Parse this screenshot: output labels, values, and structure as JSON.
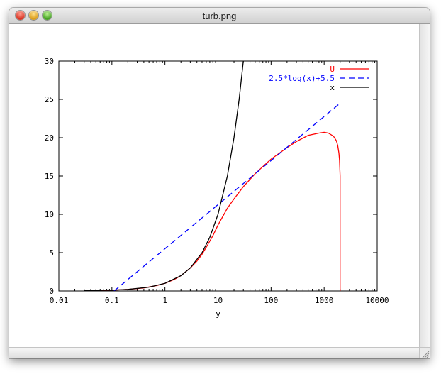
{
  "window": {
    "title": "turb.png"
  },
  "chart_data": {
    "type": "line",
    "title": "",
    "xlabel": "y",
    "ylabel": "",
    "xscale": "log",
    "xlim": [
      0.01,
      10000
    ],
    "ylim": [
      0,
      30
    ],
    "xticks": [
      "0.01",
      "0.1",
      "1",
      "10",
      "100",
      "1000",
      "10000"
    ],
    "yticks": [
      "0",
      "5",
      "10",
      "15",
      "20",
      "25",
      "30"
    ],
    "legend_position": "top-right",
    "grid": false,
    "series": [
      {
        "name": "U",
        "color": "#ff0000",
        "dash": "solid",
        "x": [
          0.03,
          0.05,
          0.1,
          0.2,
          0.4,
          0.7,
          1,
          1.5,
          2,
          3,
          4,
          5,
          6,
          8,
          10,
          15,
          20,
          30,
          50,
          80,
          100,
          200,
          300,
          500,
          800,
          1000,
          1200,
          1500,
          1700,
          1800,
          1900,
          1950,
          2000,
          2000
        ],
        "y": [
          0.03,
          0.05,
          0.1,
          0.2,
          0.4,
          0.7,
          1.0,
          1.5,
          2.0,
          3.0,
          3.9,
          4.8,
          5.7,
          7.2,
          8.6,
          10.8,
          12.0,
          13.6,
          15.3,
          16.6,
          17.2,
          18.7,
          19.5,
          20.3,
          20.6,
          20.7,
          20.6,
          20.2,
          19.6,
          19.0,
          18.0,
          17.0,
          15.0,
          0
        ]
      },
      {
        "name": "2.5*log(x)+5.5",
        "color": "#0000ff",
        "dash": "dashed",
        "x": [
          0.11,
          2000
        ],
        "y": [
          0,
          24.5
        ]
      },
      {
        "name": "x",
        "color": "#000000",
        "dash": "solid",
        "x": [
          0.03,
          0.05,
          0.1,
          0.2,
          0.5,
          1,
          2,
          3,
          5,
          7,
          10,
          15,
          20,
          25,
          30
        ],
        "y": [
          0.03,
          0.05,
          0.1,
          0.2,
          0.5,
          1,
          2,
          3,
          5,
          7,
          10,
          15,
          20,
          25,
          30
        ]
      }
    ]
  }
}
